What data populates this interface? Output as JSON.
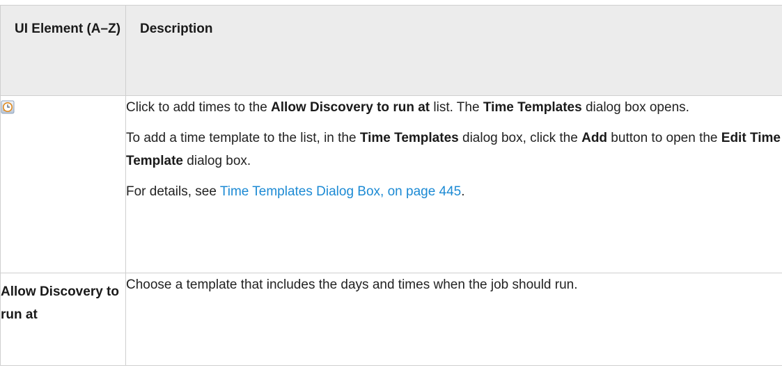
{
  "header": {
    "col1": "UI Element (A–Z)",
    "col2": "Description"
  },
  "rows": [
    {
      "element_icon": "time-template-clock-icon",
      "desc": {
        "p1_a": "Click to add times to the ",
        "p1_b": "Allow Discovery to run at",
        "p1_c": " list. The ",
        "p1_d": "Time Templates",
        "p1_e": " dialog box opens.",
        "p2_a": "To add a time template to the list, in the ",
        "p2_b": "Time Templates",
        "p2_c": " dialog box, click the ",
        "p2_d": "Add",
        "p2_e": " button to open the ",
        "p2_f": "Edit Time Template",
        "p2_g": " dialog box.",
        "p3_a": "For details, see ",
        "p3_link": "Time Templates Dialog Box, on page 445",
        "p3_b": "."
      }
    },
    {
      "element": "Allow Discovery to run at",
      "desc": "Choose a template that includes the days and times when the job should run."
    }
  ],
  "colors": {
    "header_bg": "#ececec",
    "border": "#cfcfcf",
    "link": "#1c8ad4"
  }
}
